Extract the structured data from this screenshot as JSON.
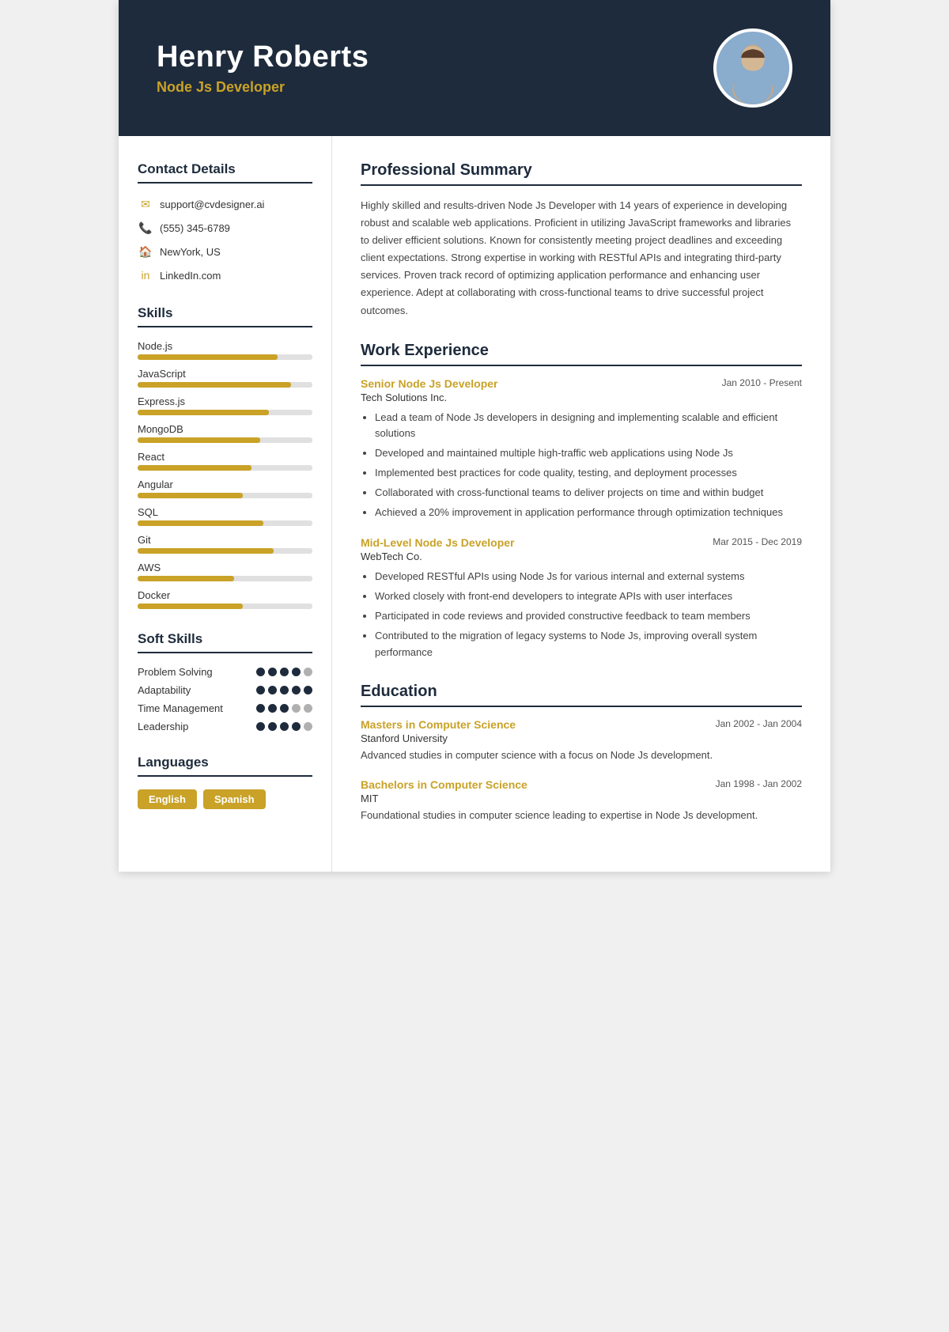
{
  "header": {
    "name": "Henry Roberts",
    "subtitle": "Node Js Developer"
  },
  "contact": {
    "title": "Contact Details",
    "items": [
      {
        "icon": "✉",
        "value": "support@cvdesigner.ai",
        "type": "email"
      },
      {
        "icon": "📞",
        "value": "(555) 345-6789",
        "type": "phone"
      },
      {
        "icon": "🏠",
        "value": "NewYork, US",
        "type": "address"
      },
      {
        "icon": "in",
        "value": "LinkedIn.com",
        "type": "linkedin"
      }
    ]
  },
  "skills": {
    "title": "Skills",
    "items": [
      {
        "name": "Node.js",
        "level": 80
      },
      {
        "name": "JavaScript",
        "level": 88
      },
      {
        "name": "Express.js",
        "level": 75
      },
      {
        "name": "MongoDB",
        "level": 70
      },
      {
        "name": "React",
        "level": 65
      },
      {
        "name": "Angular",
        "level": 60
      },
      {
        "name": "SQL",
        "level": 72
      },
      {
        "name": "Git",
        "level": 78
      },
      {
        "name": "AWS",
        "level": 55
      },
      {
        "name": "Docker",
        "level": 60
      }
    ]
  },
  "soft_skills": {
    "title": "Soft Skills",
    "items": [
      {
        "name": "Problem Solving",
        "dots": [
          1,
          1,
          1,
          1,
          0
        ]
      },
      {
        "name": "Adaptability",
        "dots": [
          1,
          1,
          1,
          1,
          1
        ]
      },
      {
        "name": "Time Management",
        "dots": [
          1,
          1,
          1,
          0,
          0
        ]
      },
      {
        "name": "Leadership",
        "dots": [
          1,
          1,
          1,
          1,
          0
        ]
      }
    ]
  },
  "languages": {
    "title": "Languages",
    "items": [
      "English",
      "Spanish"
    ]
  },
  "summary": {
    "title": "Professional Summary",
    "text": "Highly skilled and results-driven Node Js Developer with 14 years of experience in developing robust and scalable web applications. Proficient in utilizing JavaScript frameworks and libraries to deliver efficient solutions. Known for consistently meeting project deadlines and exceeding client expectations. Strong expertise in working with RESTful APIs and integrating third-party services. Proven track record of optimizing application performance and enhancing user experience. Adept at collaborating with cross-functional teams to drive successful project outcomes."
  },
  "work_experience": {
    "title": "Work Experience",
    "jobs": [
      {
        "title": "Senior Node Js Developer",
        "company": "Tech Solutions Inc.",
        "dates": "Jan 2010 - Present",
        "bullets": [
          "Lead a team of Node Js developers in designing and implementing scalable and efficient solutions",
          "Developed and maintained multiple high-traffic web applications using Node Js",
          "Implemented best practices for code quality, testing, and deployment processes",
          "Collaborated with cross-functional teams to deliver projects on time and within budget",
          "Achieved a 20% improvement in application performance through optimization techniques"
        ]
      },
      {
        "title": "Mid-Level Node Js Developer",
        "company": "WebTech Co.",
        "dates": "Mar 2015 - Dec 2019",
        "bullets": [
          "Developed RESTful APIs using Node Js for various internal and external systems",
          "Worked closely with front-end developers to integrate APIs with user interfaces",
          "Participated in code reviews and provided constructive feedback to team members",
          "Contributed to the migration of legacy systems to Node Js, improving overall system performance"
        ]
      }
    ]
  },
  "education": {
    "title": "Education",
    "items": [
      {
        "degree": "Masters in Computer Science",
        "school": "Stanford University",
        "dates": "Jan 2002 - Jan 2004",
        "desc": "Advanced studies in computer science with a focus on Node Js development."
      },
      {
        "degree": "Bachelors in Computer Science",
        "school": "MIT",
        "dates": "Jan 1998 - Jan 2002",
        "desc": "Foundational studies in computer science leading to expertise in Node Js development."
      }
    ]
  }
}
